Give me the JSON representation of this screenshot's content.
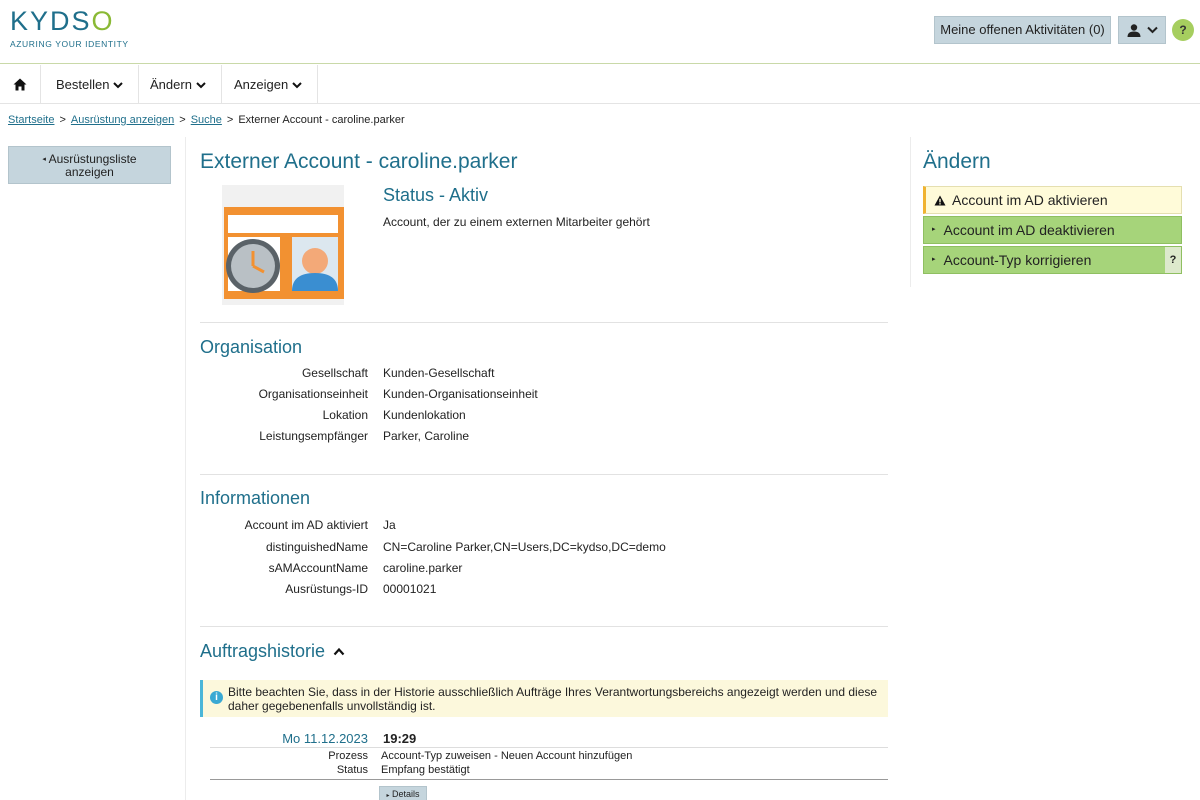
{
  "header": {
    "logo_text_k": "KYDS",
    "logo_text_o": "O",
    "logo_tagline": "AZURING YOUR IDENTITY",
    "activities_label": "Meine offenen Aktivitäten (0)",
    "help_label": "?"
  },
  "nav": {
    "items": [
      {
        "label": "Bestellen"
      },
      {
        "label": "Ändern"
      },
      {
        "label": "Anzeigen"
      }
    ]
  },
  "breadcrumb": {
    "items": [
      "Startseite",
      "Ausrüstung anzeigen",
      "Suche"
    ],
    "current": "Externer Account - caroline.parker",
    "separator": ">"
  },
  "sidebar": {
    "back_label_line1": "Ausrüstungsliste",
    "back_label_line2": "anzeigen"
  },
  "main": {
    "title": "Externer Account - caroline.parker",
    "status": "Status - Aktiv",
    "description": "Account, der zu einem externen Mitarbeiter gehört",
    "organisation": {
      "title": "Organisation",
      "rows": [
        {
          "label": "Gesellschaft",
          "value": "Kunden-Gesellschaft"
        },
        {
          "label": "Organisationseinheit",
          "value": "Kunden-Organisationseinheit"
        },
        {
          "label": "Lokation",
          "value": "Kundenlokation"
        },
        {
          "label": "Leistungsempfänger",
          "value": "Parker, Caroline"
        }
      ]
    },
    "informationen": {
      "title": "Informationen",
      "rows": [
        {
          "label": "Account im AD aktiviert",
          "value": "Ja"
        },
        {
          "label": "distinguishedName",
          "value": "CN=Caroline Parker,CN=Users,DC=kydso,DC=demo"
        },
        {
          "label": "sAMAccountName",
          "value": "caroline.parker"
        },
        {
          "label": "Ausrüstungs-ID",
          "value": "00001021"
        }
      ]
    },
    "history": {
      "title": "Auftragshistorie",
      "notice": "Bitte beachten Sie, dass in der Historie ausschließlich Aufträge Ihres Verantwortungsbereichs angezeigt werden und diese daher gegebenenfalls unvollständig ist.",
      "entry": {
        "date": "Mo 11.12.2023",
        "time": "19:29",
        "process_label": "Prozess",
        "process_value": "Account-Typ zuweisen - Neuen Account hinzufügen",
        "status_label": "Status",
        "status_value": "Empfang bestätigt",
        "details_label": "Details"
      }
    }
  },
  "right": {
    "title": "Ändern",
    "actions": [
      {
        "label": "Account im AD aktivieren",
        "style": "warning"
      },
      {
        "label": "Account im AD deaktivieren",
        "style": "green"
      },
      {
        "label": "Account-Typ korrigieren",
        "style": "green",
        "help": "?"
      }
    ]
  },
  "colors": {
    "brand_blue": "#1f6f8b",
    "brand_green": "#8ab935",
    "action_green": "#a6d47a",
    "warning_bg": "#fffbd9",
    "button_grey_blue": "#c5d5dd"
  }
}
